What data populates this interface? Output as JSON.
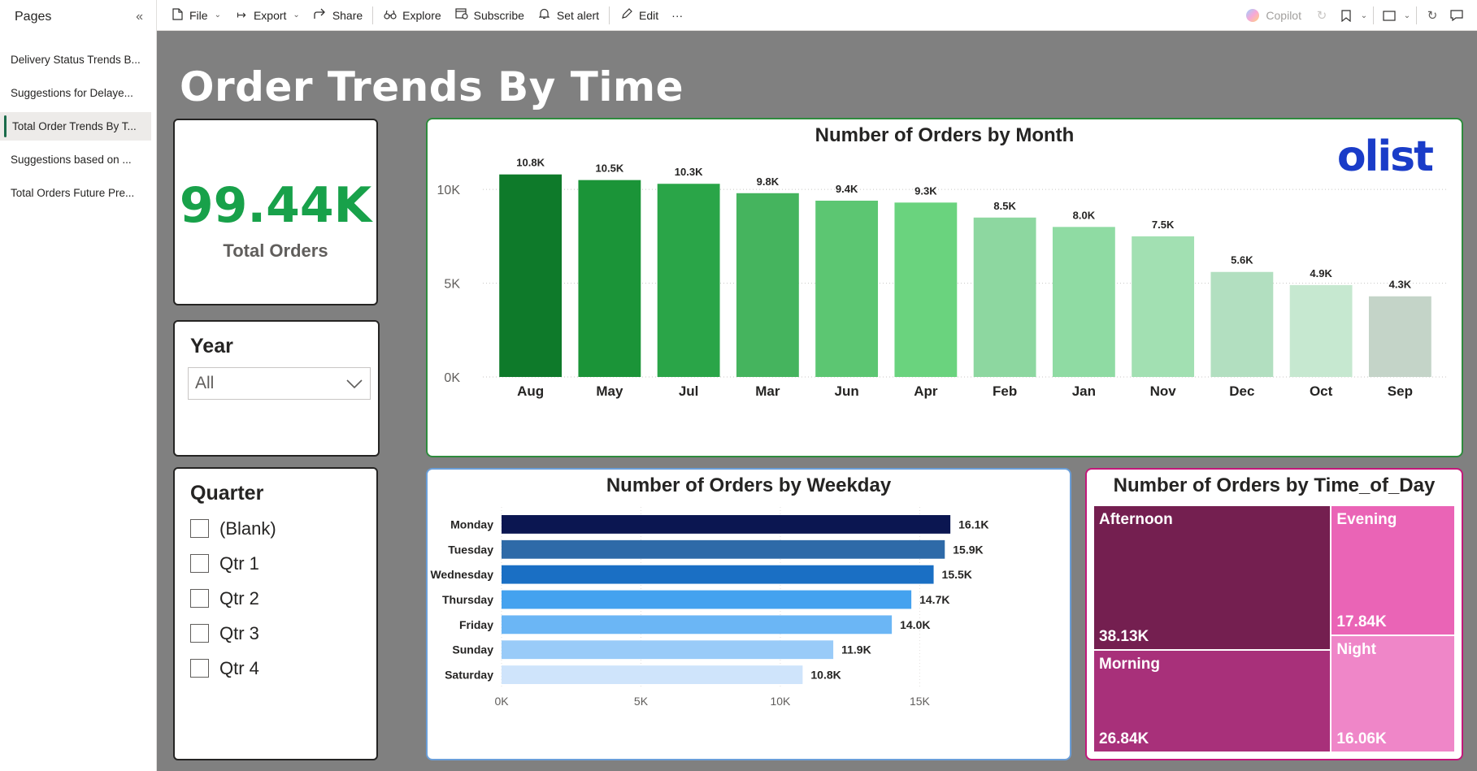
{
  "sidebar": {
    "title": "Pages",
    "pages": [
      {
        "label": "Delivery Status Trends B..."
      },
      {
        "label": "Suggestions for Delaye..."
      },
      {
        "label": "Total Order Trends By T..."
      },
      {
        "label": "Suggestions based on ..."
      },
      {
        "label": "Total Orders Future Pre..."
      }
    ],
    "active_index": 2
  },
  "toolbar": {
    "file": "File",
    "export": "Export",
    "share": "Share",
    "explore": "Explore",
    "subscribe": "Subscribe",
    "set_alert": "Set alert",
    "edit": "Edit",
    "more": "···",
    "copilot": "Copilot"
  },
  "report": {
    "title": "Order Trends By Time",
    "kpi": {
      "value": "99.44K",
      "label": "Total Orders"
    },
    "year_slicer": {
      "title": "Year",
      "selected": "All"
    },
    "quarter_slicer": {
      "title": "Quarter",
      "options": [
        "(Blank)",
        "Qtr 1",
        "Qtr 2",
        "Qtr 3",
        "Qtr 4"
      ]
    },
    "logo": "olist",
    "colors": {
      "kpi_green": "#18a14a",
      "month_border": "#2e8b3d",
      "week_border": "#6a9ed8",
      "tod_border": "#c2187a"
    }
  },
  "chart_data": [
    {
      "type": "bar",
      "title": "Number of Orders by Month",
      "categories": [
        "Aug",
        "May",
        "Jul",
        "Mar",
        "Jun",
        "Apr",
        "Feb",
        "Jan",
        "Nov",
        "Dec",
        "Oct",
        "Sep"
      ],
      "values": [
        10800,
        10500,
        10300,
        9800,
        9400,
        9300,
        8500,
        8000,
        7500,
        5600,
        4900,
        4300
      ],
      "labels": [
        "10.8K",
        "10.5K",
        "10.3K",
        "9.8K",
        "9.4K",
        "9.3K",
        "8.5K",
        "8.0K",
        "7.5K",
        "5.6K",
        "4.9K",
        "4.3K"
      ],
      "colors": [
        "#0e7a2a",
        "#1b9438",
        "#2aa548",
        "#45b45e",
        "#5cc672",
        "#6ad37e",
        "#8dd7a0",
        "#8fdba3",
        "#a2e0b2",
        "#b2dfc0",
        "#c6e8d0",
        "#c4d4c8"
      ],
      "yticks": [
        0,
        5000,
        10000
      ],
      "ytick_labels": [
        "0K",
        "5K",
        "10K"
      ],
      "ylim": [
        0,
        12000
      ]
    },
    {
      "type": "bar",
      "orientation": "horizontal",
      "title": "Number of Orders by Weekday",
      "categories": [
        "Monday",
        "Tuesday",
        "Wednesday",
        "Thursday",
        "Friday",
        "Sunday",
        "Saturday"
      ],
      "values": [
        16100,
        15900,
        15500,
        14700,
        14000,
        11900,
        10800
      ],
      "labels": [
        "16.1K",
        "15.9K",
        "15.5K",
        "14.7K",
        "14.0K",
        "11.9K",
        "10.8K"
      ],
      "colors": [
        "#0b1651",
        "#2e6aa8",
        "#1a6fc4",
        "#44a2ef",
        "#6bb6f5",
        "#99cbf8",
        "#cfe4fb"
      ],
      "xticks": [
        0,
        5000,
        10000,
        15000
      ],
      "xtick_labels": [
        "0K",
        "5K",
        "10K",
        "15K"
      ],
      "xlim": [
        0,
        17000
      ]
    },
    {
      "type": "treemap",
      "title": "Number of Orders by Time_of_Day",
      "categories": [
        "Afternoon",
        "Morning",
        "Evening",
        "Night"
      ],
      "values": [
        38130,
        26840,
        17840,
        16060
      ],
      "labels": [
        "38.13K",
        "26.84K",
        "17.84K",
        "16.06K"
      ],
      "colors": [
        "#741f50",
        "#a8307a",
        "#ea64b6",
        "#ef86c8"
      ]
    }
  ]
}
